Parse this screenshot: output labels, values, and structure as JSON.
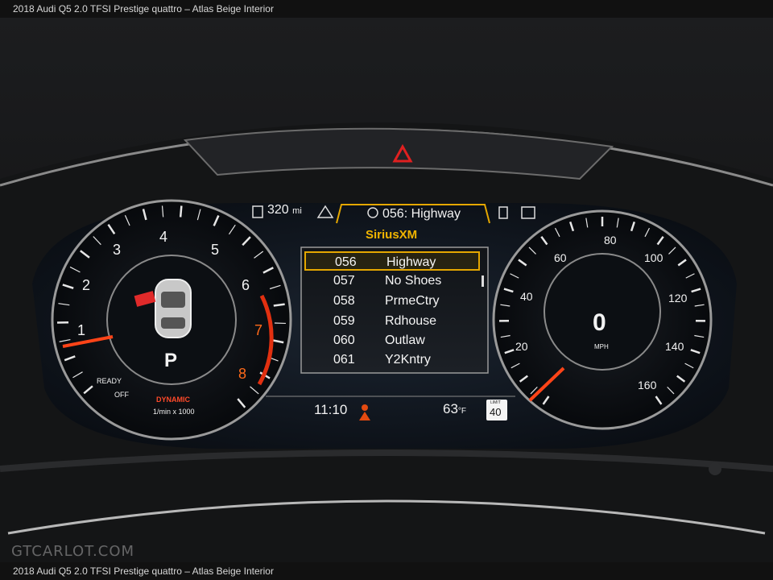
{
  "caption": {
    "top": "2018 Audi Q5 2.0 TFSI Prestige quattro – Atlas Beige Interior",
    "bottom": "2018 Audi Q5 2.0 TFSI Prestige quattro – Atlas Beige Interior"
  },
  "cluster": {
    "range": "320",
    "range_unit": "mi",
    "now_playing": "056: Highway",
    "source": "SiriusXM",
    "stations": [
      {
        "num": "056",
        "name": "Highway",
        "selected": true
      },
      {
        "num": "057",
        "name": "No Shoes",
        "selected": false
      },
      {
        "num": "058",
        "name": "PrmeCtry",
        "selected": false
      },
      {
        "num": "059",
        "name": "Rdhouse",
        "selected": false
      },
      {
        "num": "060",
        "name": "Outlaw",
        "selected": false
      },
      {
        "num": "061",
        "name": "Y2Kntry",
        "selected": false
      }
    ],
    "time": "11:10",
    "temperature": "63",
    "temp_unit": "°F",
    "speed_limit_label": "LIMIT",
    "speed_limit": "40",
    "gear": "P",
    "speed": "0",
    "speed_unit": "MPH",
    "ready": "READY",
    "off": "OFF",
    "drive_mode": "DYNAMIC",
    "rpm_unit": "1/min x 1000",
    "tach_labels": [
      "1",
      "2",
      "3",
      "4",
      "5",
      "6",
      "7",
      "8"
    ],
    "speed_labels": [
      "20",
      "40",
      "60",
      "80",
      "100",
      "120",
      "140",
      "160"
    ]
  },
  "watermark": "GTCARLOT.COM"
}
